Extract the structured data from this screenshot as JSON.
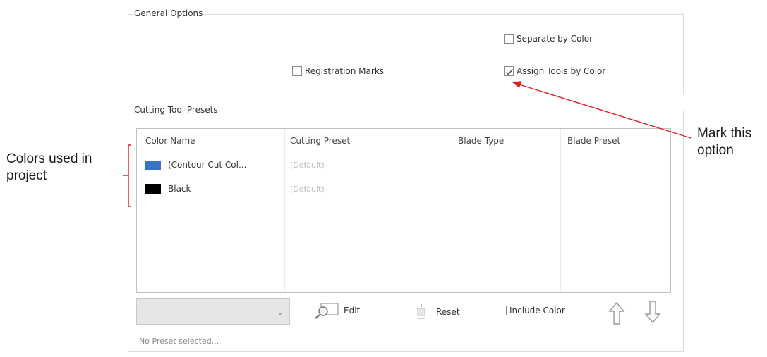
{
  "general_options": {
    "title": "General Options",
    "separate_by_color": {
      "label": "Separate by Color",
      "checked": false
    },
    "registration_marks": {
      "label": "Registration Marks",
      "checked": false
    },
    "assign_tools_by_color": {
      "label": "Assign Tools by Color",
      "checked": true
    }
  },
  "cutting_tool_presets": {
    "title": "Cutting Tool Presets",
    "columns": [
      "Color Name",
      "Cutting Preset",
      "Blade Type",
      "Blade Preset"
    ],
    "rows": [
      {
        "color": "#3a73c4",
        "name": "(Contour Cut Col...",
        "preset": "(Default)"
      },
      {
        "color": "#000000",
        "name": "Black",
        "preset": "(Default)"
      }
    ],
    "dropdown_value": "",
    "edit_label": "Edit",
    "reset_label": "Reset",
    "include_color": {
      "label": "Include Color",
      "checked": false
    },
    "status": "No Preset selected..."
  },
  "annotations": {
    "left_line1": "Colors used in",
    "left_line2": "project",
    "right_line1": "Mark this",
    "right_line2": "option",
    "accent": "#e02020"
  }
}
